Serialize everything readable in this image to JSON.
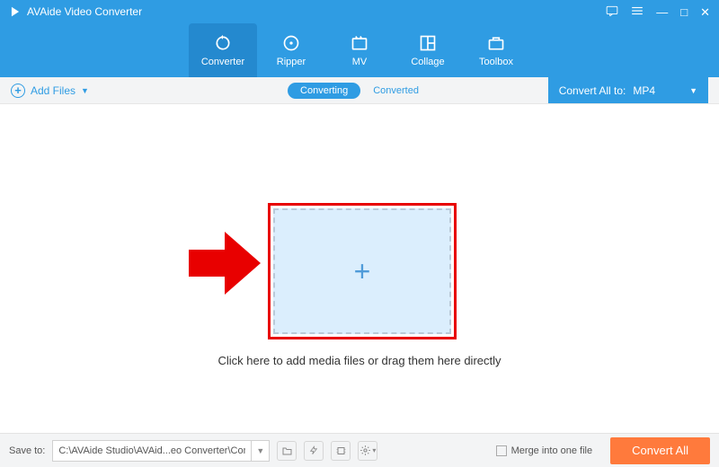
{
  "titlebar": {
    "app_name": "AVAide Video Converter"
  },
  "nav": {
    "items": [
      {
        "label": "Converter"
      },
      {
        "label": "Ripper"
      },
      {
        "label": "MV"
      },
      {
        "label": "Collage"
      },
      {
        "label": "Toolbox"
      }
    ]
  },
  "toolbar": {
    "add_files_label": "Add Files",
    "converting_label": "Converting",
    "converted_label": "Converted",
    "convert_all_to_label": "Convert All to:",
    "selected_format": "MP4"
  },
  "main": {
    "instruction": "Click here to add media files or drag them here directly"
  },
  "footer": {
    "save_to_label": "Save to:",
    "save_path": "C:\\AVAide Studio\\AVAid...eo Converter\\Converted",
    "merge_label": "Merge into one file",
    "convert_button": "Convert All"
  },
  "colors": {
    "primary": "#2f9ce3",
    "accent": "#ff7a3c",
    "highlight_red": "#e80000"
  }
}
